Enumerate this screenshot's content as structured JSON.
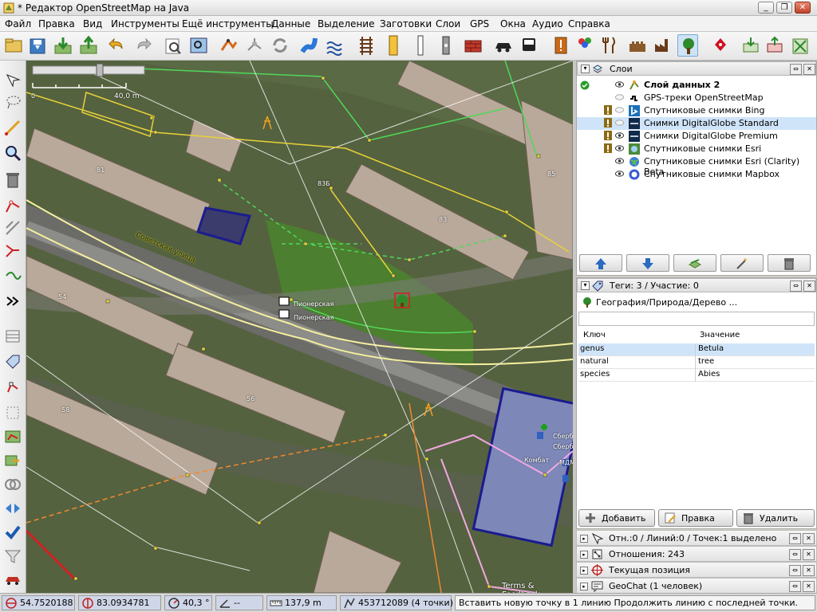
{
  "window": {
    "title": "* Редактор OpenStreetMap на Java"
  },
  "menu": [
    "Файл",
    "Правка",
    "Вид",
    "Инструменты",
    "Ещё инструменты",
    "Данные",
    "Выделение",
    "Заготовки",
    "Слои",
    "GPS",
    "Окна",
    "Аудио",
    "Справка"
  ],
  "toolbar_icons": [
    "open-icon",
    "save-icon",
    "download-icon",
    "upload-icon",
    "undo-icon",
    "redo-icon",
    "preferences-icon",
    "zoom-preview-icon",
    "shortcuts-icon",
    "water-icon",
    "water-waves-icon",
    "railway-icon",
    "road-icon",
    "building-icon",
    "wall-icon",
    "car-icon",
    "bus-icon",
    "alert-icon",
    "balloons-icon",
    "food-icon",
    "castle-icon",
    "factory-icon",
    "tree-icon",
    "poi-icon",
    "download-area-icon",
    "upload-area-icon",
    "resize-icon"
  ],
  "left_tools": [
    "select-icon",
    "lasso-icon",
    "draw-icon",
    "zoom-icon",
    "delete-icon",
    "improve-way-icon",
    "parallel-icon",
    "extrude-icon",
    "split-icon",
    "more-icon",
    "layer-toggle-icon",
    "tag-icon",
    "node-icon",
    "measure-icon",
    "area-icon",
    "copy-icon",
    "combine-icon",
    "reverse-icon",
    "validate-icon",
    "filter-icon",
    "car-icon"
  ],
  "map": {
    "scale_label": "40,0 m",
    "scale_zero": "0",
    "labels": [
      "Советская улица",
      "Пионерская",
      "Пионерская",
      "Сбербанк",
      "Сбербанк",
      "Комбат",
      "МДМ",
      "83Б",
      "81",
      "83",
      "85",
      "54",
      "56",
      "58"
    ],
    "terms": "Terms & Feedback"
  },
  "layers_panel": {
    "title": "Слои",
    "items": [
      {
        "name": "Слой данных 2",
        "active": true,
        "visible": true
      },
      {
        "name": "GPS-треки OpenStreetMap",
        "visible": false
      },
      {
        "name": "Спутниковые снимки Bing",
        "visible": false
      },
      {
        "name": "Снимки DigitalGlobe Standard",
        "visible": false,
        "selected": true
      },
      {
        "name": "Снимки DigitalGlobe Premium",
        "visible": true
      },
      {
        "name": "Спутниковые снимки Esri",
        "visible": true
      },
      {
        "name": "Спутниковые снимки Esri (Clarity) Beta",
        "visible": true
      },
      {
        "name": "Спутниковые снимки Mapbox",
        "visible": true
      }
    ]
  },
  "tags_panel": {
    "title": "Теги: 3 / Участие: 0",
    "preset": "География/Природа/Дерево ...",
    "columns": [
      "Ключ",
      "Значение"
    ],
    "rows": [
      {
        "key": "genus",
        "value": "Betula"
      },
      {
        "key": "natural",
        "value": "tree"
      },
      {
        "key": "species",
        "value": "Abies"
      }
    ],
    "buttons": {
      "add": "Добавить",
      "edit": "Правка",
      "delete": "Удалить"
    }
  },
  "collapsed_panels": [
    "Отн.:0 / Линий:0 / Точек:1 выделено",
    "Отношения: 243",
    "Текущая позиция",
    "GeoChat (1 человек)"
  ],
  "status": {
    "lat": "54.7520188",
    "lon": "83.0934781",
    "heading": "40,3 °",
    "angle": "--",
    "length": "137,9 m",
    "way": "453712089 (4 точки)",
    "message": "Вставить новую точку в 1 линию Продолжить линию с последней точки."
  },
  "colors": {
    "accent": "#3a7fd0",
    "panel_bg": "#ffffff",
    "selection": "#cfe4f8"
  }
}
